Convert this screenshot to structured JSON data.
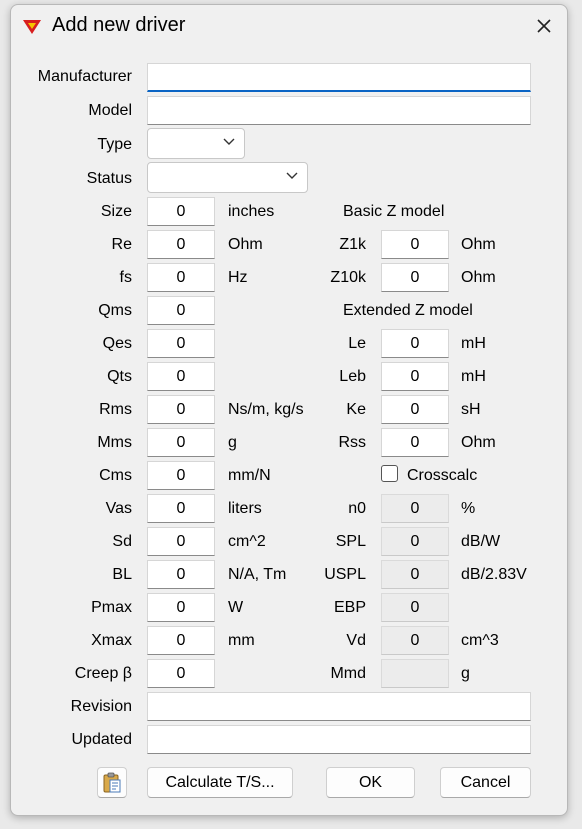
{
  "window": {
    "title": "Add new driver",
    "icon": "app-logo-icon",
    "close_icon": "close-icon"
  },
  "fields": {
    "manufacturer": {
      "label": "Manufacturer",
      "value": ""
    },
    "model": {
      "label": "Model",
      "value": ""
    },
    "type": {
      "label": "Type",
      "value": ""
    },
    "status": {
      "label": "Status",
      "value": ""
    },
    "size": {
      "label": "Size",
      "value": "0",
      "unit": "inches"
    },
    "re": {
      "label": "Re",
      "value": "0",
      "unit": "Ohm"
    },
    "fs": {
      "label": "fs",
      "value": "0",
      "unit": "Hz"
    },
    "qms": {
      "label": "Qms",
      "value": "0"
    },
    "qes": {
      "label": "Qes",
      "value": "0"
    },
    "qts": {
      "label": "Qts",
      "value": "0"
    },
    "rms": {
      "label": "Rms",
      "value": "0",
      "unit": "Ns/m, kg/s"
    },
    "mms": {
      "label": "Mms",
      "value": "0",
      "unit": "g"
    },
    "cms": {
      "label": "Cms",
      "value": "0",
      "unit": "mm/N"
    },
    "vas": {
      "label": "Vas",
      "value": "0",
      "unit": "liters"
    },
    "sd": {
      "label": "Sd",
      "value": "0",
      "unit": "cm^2"
    },
    "bl": {
      "label": "BL",
      "value": "0",
      "unit": "N/A, Tm"
    },
    "pmax": {
      "label": "Pmax",
      "value": "0",
      "unit": "W"
    },
    "xmax": {
      "label": "Xmax",
      "value": "0",
      "unit": "mm"
    },
    "creep": {
      "label": "Creep β",
      "value": "0"
    },
    "revision": {
      "label": "Revision",
      "value": ""
    },
    "updated": {
      "label": "Updated",
      "value": ""
    }
  },
  "right": {
    "basic_header": "Basic Z model",
    "z1k": {
      "label": "Z1k",
      "value": "0",
      "unit": "Ohm"
    },
    "z10k": {
      "label": "Z10k",
      "value": "0",
      "unit": "Ohm"
    },
    "extended_header": "Extended Z model",
    "le": {
      "label": "Le",
      "value": "0",
      "unit": "mH"
    },
    "leb": {
      "label": "Leb",
      "value": "0",
      "unit": "mH"
    },
    "ke": {
      "label": "Ke",
      "value": "0",
      "unit": "sH"
    },
    "rss": {
      "label": "Rss",
      "value": "0",
      "unit": "Ohm"
    },
    "crosscalc": {
      "label": "Crosscalc",
      "checked": false
    },
    "n0": {
      "label": "n0",
      "value": "0",
      "unit": "%"
    },
    "spl": {
      "label": "SPL",
      "value": "0",
      "unit": "dB/W"
    },
    "uspl": {
      "label": "USPL",
      "value": "0",
      "unit": "dB/2.83V"
    },
    "ebp": {
      "label": "EBP",
      "value": "0"
    },
    "vd": {
      "label": "Vd",
      "value": "0",
      "unit": "cm^3"
    },
    "mmd": {
      "label": "Mmd",
      "value": "",
      "unit": "g"
    }
  },
  "buttons": {
    "clipboard_icon": "clipboard-paste-icon",
    "calculate": "Calculate T/S...",
    "ok": "OK",
    "cancel": "Cancel"
  },
  "colors": {
    "focus_accent": "#0a64c4",
    "logo_red": "#d81e1e",
    "logo_yellow": "#f5c400"
  }
}
